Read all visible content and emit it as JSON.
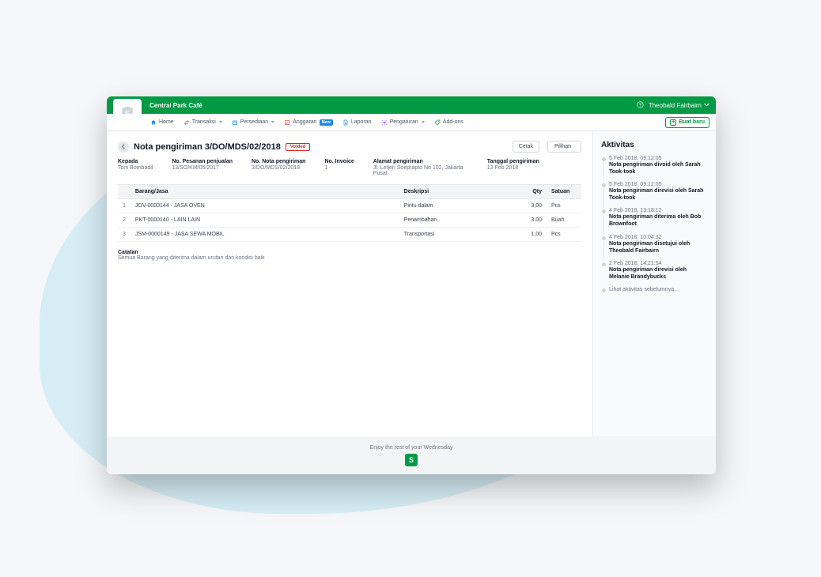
{
  "brand": {
    "company": "Central Park Café",
    "user": "Theobald Fairbairn"
  },
  "nav": {
    "home": "Home",
    "transaksi": "Transaksi",
    "persediaan": "Persediaan",
    "anggaran": "Anggaran",
    "anggaran_badge": "New",
    "laporan": "Laporan",
    "pengaturan": "Pengaturan",
    "addons": "Add-ons",
    "buat_baru": "Buat baru"
  },
  "page": {
    "title": "Nota pengiriman 3/DO/MDS/02/2018",
    "status": "Voided",
    "print_btn": "Cetak",
    "select_btn": "Pilihan"
  },
  "meta": {
    "kepada_label": "Kepada",
    "kepada_value": "Tom Bombadil",
    "so_label": "No. Pesanan penjualan",
    "so_value": "13/SO/KM/05/2017",
    "do_label": "No. Nota pengiriman",
    "do_value": "3/DO/MDS/02/2018",
    "inv_label": "No. Invoice",
    "inv_value": "1",
    "addr_label": "Alamat pengiriman",
    "addr_value": "Jl. Letjen Soeprapto No 102, Jakarta Pusat",
    "date_label": "Tanggal pengiriman",
    "date_value": "13 Feb 2018"
  },
  "table": {
    "headers": {
      "item": "Barang/Jasa",
      "desc": "Deskripsi",
      "qty": "Qty",
      "unit": "Satuan"
    },
    "rows": [
      {
        "idx": "1",
        "item": "JOV-0000144 - JASA OVEN",
        "desc": "Pintu dalam",
        "qty": "3,00",
        "unit": "Pcs"
      },
      {
        "idx": "2",
        "item": "PKT-0000140 - LAIN LAIN",
        "desc": "Penambahan",
        "qty": "3,00",
        "unit": "Buah"
      },
      {
        "idx": "3",
        "item": "JSM-0000149 - JASA SEWA MOBIL",
        "desc": "Transportasi",
        "qty": "1,00",
        "unit": "Pcs"
      }
    ]
  },
  "notes": {
    "title": "Catatan",
    "content": "Semua Barang yang diterima dalam urutan dan kondisi baik"
  },
  "activity": {
    "title": "Aktivitas",
    "items": [
      {
        "time": "5 Feb 2018, 09:12:05",
        "text": "Nota pengiriman divoid oleh Sarah Took-took"
      },
      {
        "time": "5 Feb 2018, 09:12:05",
        "text": "Nota pengiriman direvisi oleh Sarah Took-took"
      },
      {
        "time": "4 Feb 2018, 13:18:12",
        "text": "Nota pengiriman diterima oleh Bob Brownfoot"
      },
      {
        "time": "4 Feb 2018, 10:04:32",
        "text": "Nota pengiriman disetujui oleh Theobald Fairbairn"
      },
      {
        "time": "2 Feb 2018, 14:21:54",
        "text": "Nota pengiriman direvisi oleh Melanie Brandybucks"
      }
    ],
    "more": "Lihat aktivitas sebelumnya..."
  },
  "footer": {
    "text": "Enjoy the rest of your Wednesday"
  }
}
